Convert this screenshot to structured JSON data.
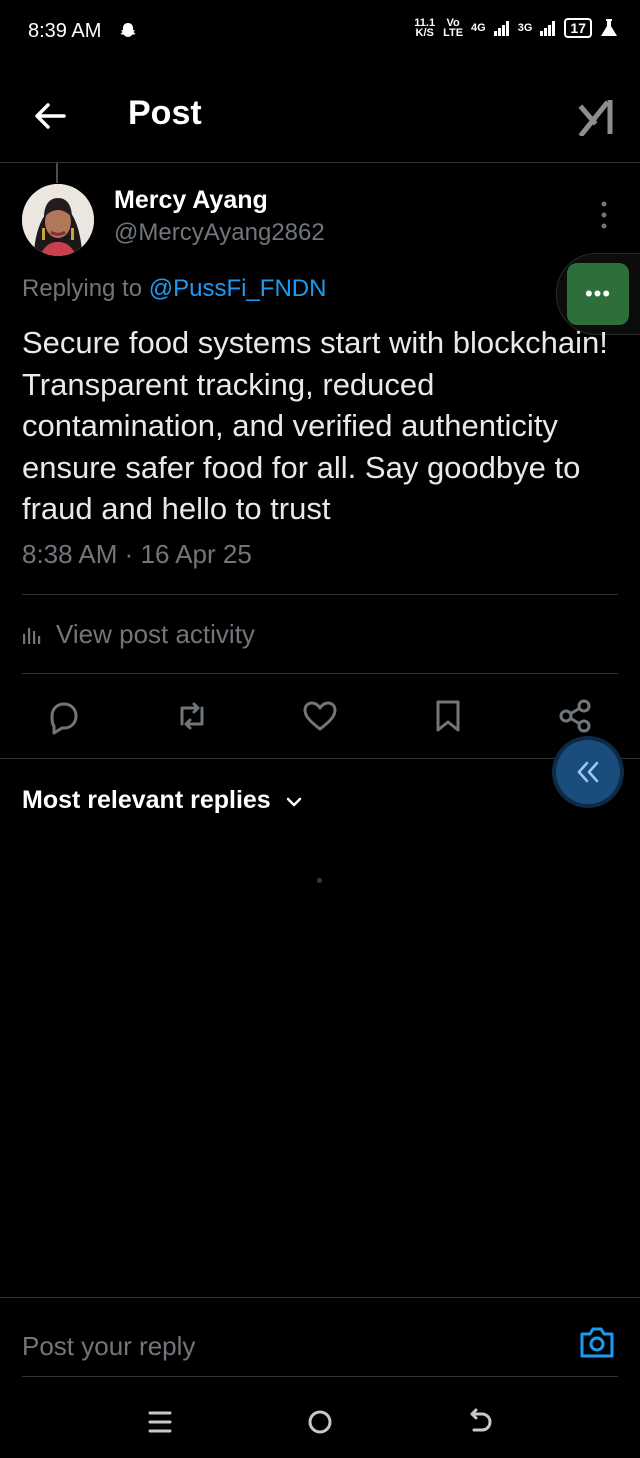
{
  "status_bar": {
    "time": "8:39 AM",
    "net_speed_value": "11.1",
    "net_speed_unit": "K/S",
    "volte_top": "Vo",
    "volte_bottom": "LTE",
    "network_4g": "4G",
    "network_3g": "3G",
    "battery": "17"
  },
  "header": {
    "title": "Post",
    "back_icon": "arrow-left-icon",
    "grok_icon": "grok-icon"
  },
  "post": {
    "author_name": "Mercy Ayang",
    "author_handle": "@MercyAyang2862",
    "replying_prefix": "Replying to ",
    "replying_to": "@PussFi_FNDN",
    "text": "Secure food systems start with blockchain! Transparent tracking, reduced contamination, and verified authenticity ensure safer food for all. Say goodbye to fraud and hello to trust",
    "timestamp": "8:38 AM · 16 Apr 25",
    "activity_label": "View post activity"
  },
  "actions": [
    "reply-icon",
    "repost-icon",
    "like-icon",
    "bookmark-icon",
    "share-icon"
  ],
  "floating": {
    "more_label": "•••",
    "scroll_icon": "double-chevron-left-icon"
  },
  "replies": {
    "sort_label": "Most relevant replies"
  },
  "composer": {
    "placeholder": "Post your reply"
  },
  "colors": {
    "background": "#000000",
    "text_primary": "#e7e9ea",
    "text_secondary": "#71767b",
    "accent_blue": "#1d9bf0",
    "divider": "#2f3336",
    "green_button": "#2d6e3a"
  }
}
